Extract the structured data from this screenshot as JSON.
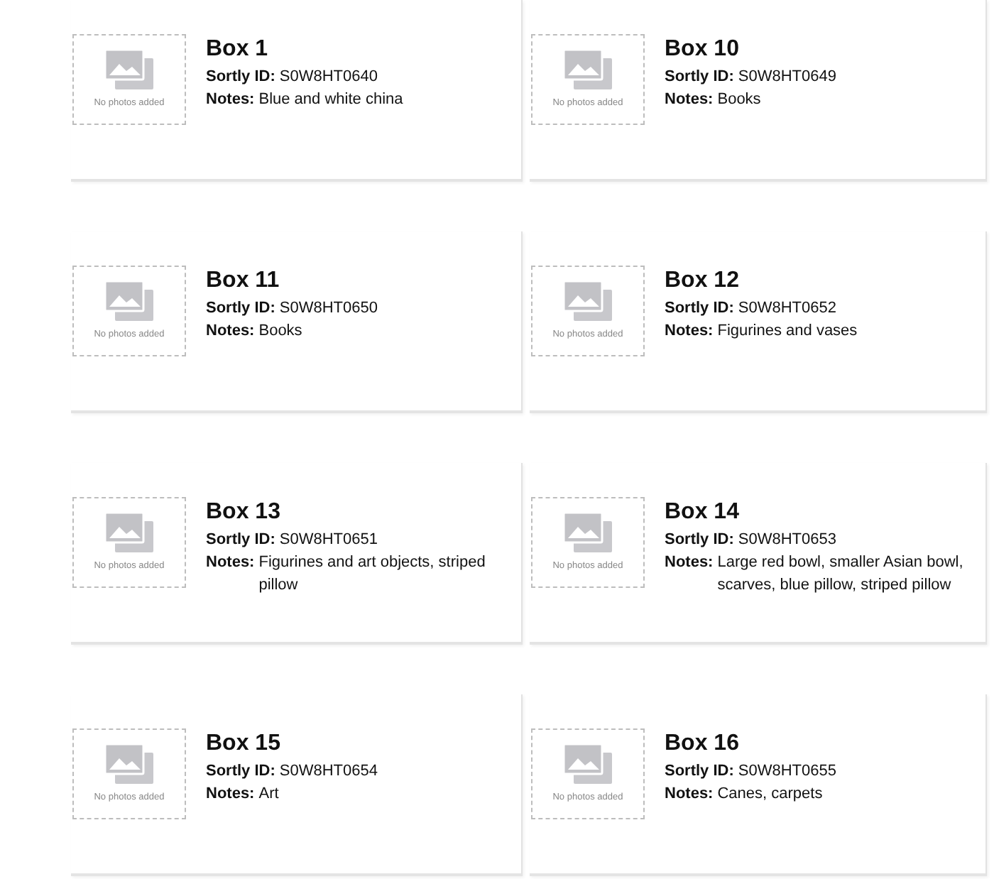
{
  "boxes": [
    {
      "title": "Box 1",
      "id_label": "Sortly ID:",
      "sortly_id": "S0W8HT0640",
      "notes_label": "Notes:",
      "notes": "Blue and white china",
      "photo_text": "No photos added"
    },
    {
      "title": "Box 10",
      "id_label": "Sortly ID:",
      "sortly_id": "S0W8HT0649",
      "notes_label": "Notes:",
      "notes": "Books",
      "photo_text": "No photos added"
    },
    {
      "title": "Box 11",
      "id_label": "Sortly ID:",
      "sortly_id": "S0W8HT0650",
      "notes_label": "Notes:",
      "notes": "Books",
      "photo_text": "No photos added"
    },
    {
      "title": "Box 12",
      "id_label": "Sortly ID:",
      "sortly_id": "S0W8HT0652",
      "notes_label": "Notes:",
      "notes": "Figurines and vases",
      "photo_text": "No photos added"
    },
    {
      "title": "Box 13",
      "id_label": "Sortly ID:",
      "sortly_id": "S0W8HT0651",
      "notes_label": "Notes:",
      "notes": "Figurines and art objects, striped pillow",
      "photo_text": "No photos added"
    },
    {
      "title": "Box 14",
      "id_label": "Sortly ID:",
      "sortly_id": "S0W8HT0653",
      "notes_label": "Notes:",
      "notes": "Large red bowl, smaller Asian bowl, scarves, blue pillow, striped pillow",
      "photo_text": "No photos added"
    },
    {
      "title": "Box 15",
      "id_label": "Sortly ID:",
      "sortly_id": "S0W8HT0654",
      "notes_label": "Notes:",
      "notes": "Art",
      "photo_text": "No photos added"
    },
    {
      "title": "Box 16",
      "id_label": "Sortly ID:",
      "sortly_id": "S0W8HT0655",
      "notes_label": "Notes:",
      "notes": "Canes, carpets",
      "photo_text": "No photos added"
    }
  ]
}
